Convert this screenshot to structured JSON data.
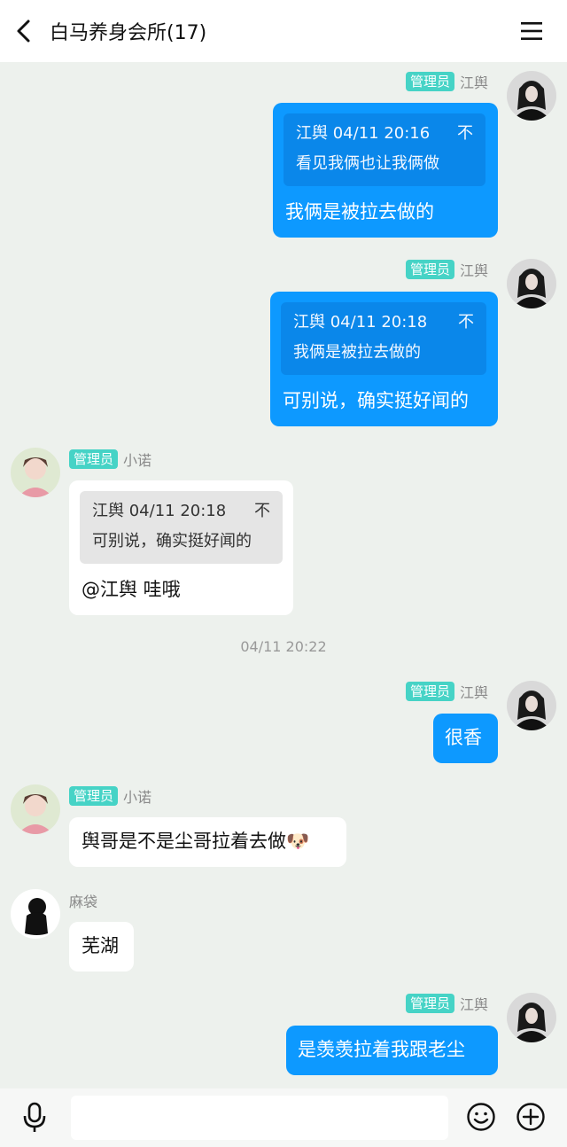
{
  "header": {
    "title": "白马养身会所(17)",
    "back_icon": "chevron-left-icon",
    "menu_icon": "hamburger-menu-icon"
  },
  "messages": [
    {
      "direction": "out",
      "badge": "管理员",
      "sender": "江舆",
      "quote": {
        "author_time": "江舆 04/11 20:16",
        "tail": "不",
        "text": "看见我俩也让我俩做"
      },
      "text": "我俩是被拉去做的"
    },
    {
      "direction": "out",
      "badge": "管理员",
      "sender": "江舆",
      "quote": {
        "author_time": "江舆 04/11 20:18",
        "tail": "不",
        "text": "我俩是被拉去做的"
      },
      "text": "可别说，确实挺好闻的"
    },
    {
      "direction": "in",
      "badge": "管理员",
      "sender": "小诺",
      "quote": {
        "author_time": "江舆 04/11 20:18",
        "tail": "不",
        "text": "可别说，确实挺好闻的"
      },
      "text": "@江舆 哇哦"
    },
    {
      "direction": "out",
      "badge": "管理员",
      "sender": "江舆",
      "text": "很香"
    },
    {
      "direction": "in",
      "badge": "管理员",
      "sender": "小诺",
      "text": "舆哥是不是尘哥拉着去做",
      "emoji": "🐶"
    },
    {
      "direction": "in",
      "sender": "麻袋",
      "text": "芜湖"
    },
    {
      "direction": "out",
      "badge": "管理员",
      "sender": "江舆",
      "text": "是羡羡拉着我跟老尘"
    }
  ],
  "time_separator": "04/11 20:22",
  "colors": {
    "outgoing_bubble": "#0d99ff",
    "incoming_bubble": "#ffffff",
    "admin_badge": "#46d3c6",
    "background": "#edf1ed"
  },
  "bottom_bar": {
    "mic_icon": "microphone-icon",
    "input_placeholder": "",
    "emoji_icon": "smiley-icon",
    "plus_icon": "plus-circle-icon"
  }
}
